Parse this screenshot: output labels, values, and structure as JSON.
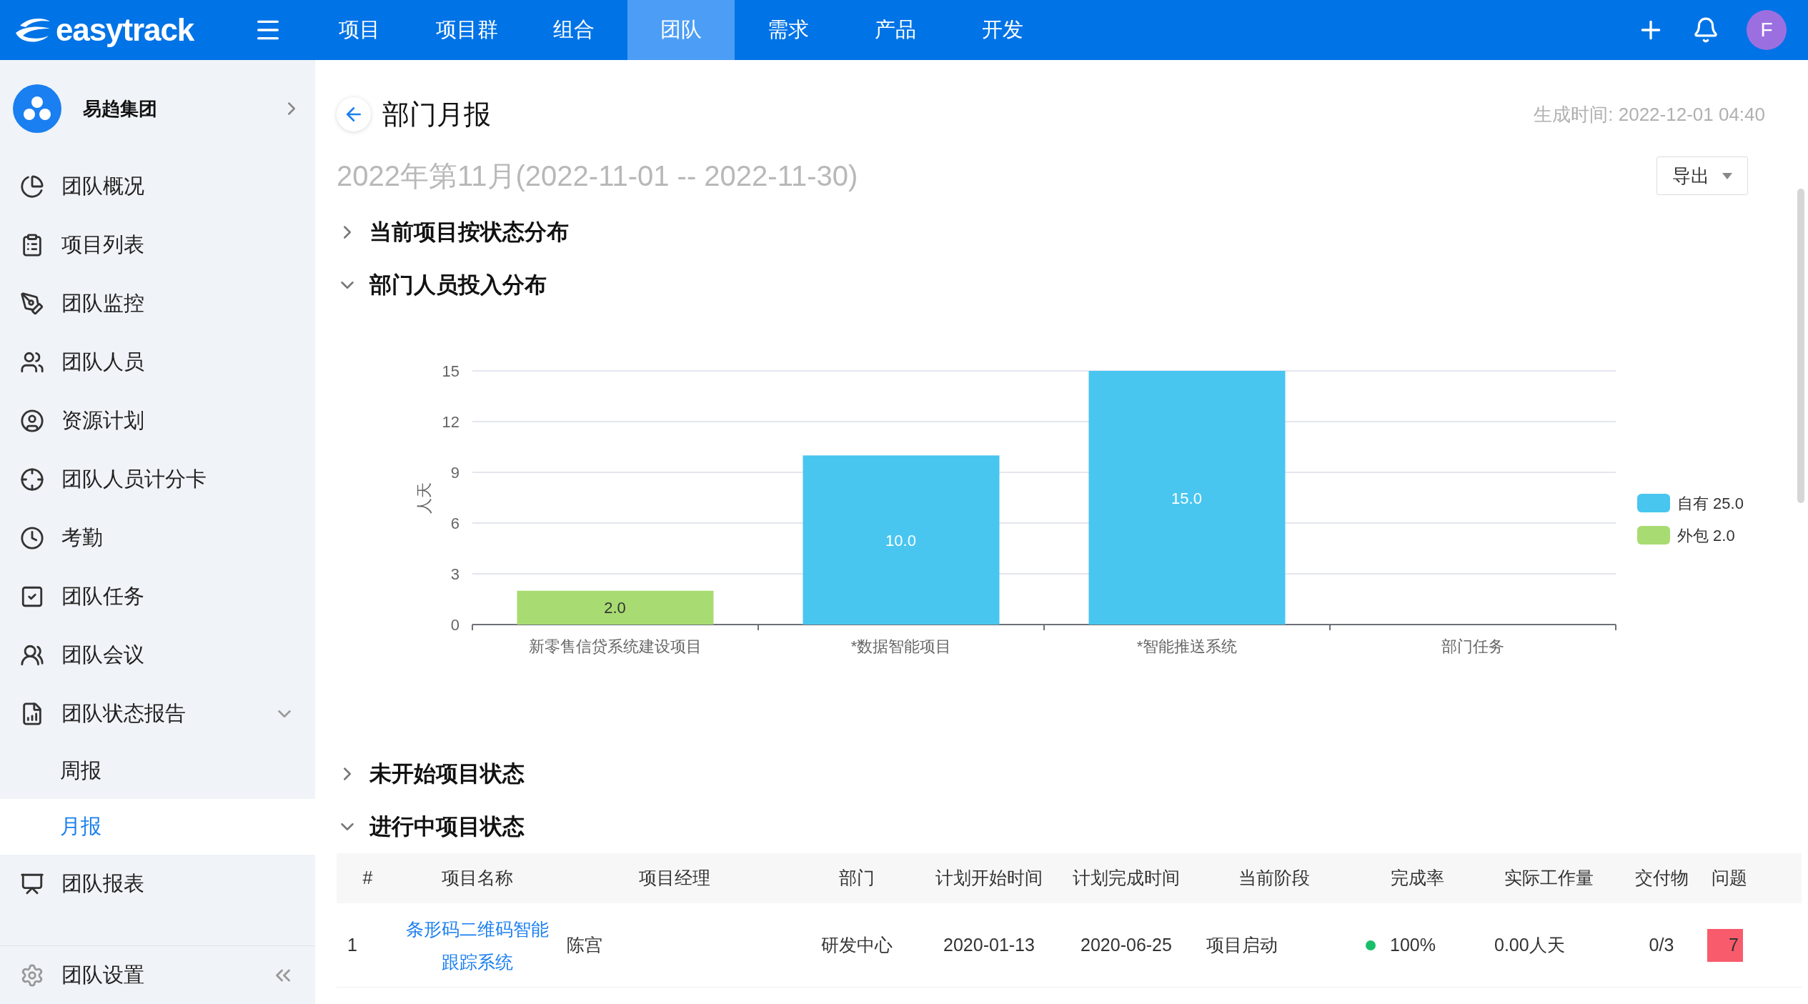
{
  "topbar": {
    "logo": "easytrack",
    "tabs": [
      {
        "label": "项目",
        "selected": false
      },
      {
        "label": "项目群",
        "selected": false
      },
      {
        "label": "组合",
        "selected": false
      },
      {
        "label": "团队",
        "selected": true
      },
      {
        "label": "需求",
        "selected": false
      },
      {
        "label": "产品",
        "selected": false
      },
      {
        "label": "开发",
        "selected": false
      }
    ],
    "avatar": "F"
  },
  "sidebar": {
    "org": "易趋集团",
    "items": [
      {
        "label": "团队概况",
        "selected": false
      },
      {
        "label": "项目列表",
        "selected": false
      },
      {
        "label": "团队监控",
        "selected": false
      },
      {
        "label": "团队人员",
        "selected": false
      },
      {
        "label": "资源计划",
        "selected": false
      },
      {
        "label": "团队人员计分卡",
        "selected": false
      },
      {
        "label": "考勤",
        "selected": false
      },
      {
        "label": "团队任务",
        "selected": false
      },
      {
        "label": "团队会议",
        "selected": false
      },
      {
        "label": "团队状态报告",
        "selected": false,
        "expanded": true,
        "children": [
          {
            "label": "周报",
            "selected": false
          },
          {
            "label": "月报",
            "selected": true
          }
        ]
      },
      {
        "label": "团队报表",
        "selected": false
      }
    ],
    "footer": "团队设置"
  },
  "page": {
    "title": "部门月报",
    "generated": "生成时间: 2022-12-01 04:40",
    "period": "2022年第11月(2022-11-01 -- 2022-11-30)",
    "export": "导出"
  },
  "sections": [
    {
      "title": "当前项目按状态分布",
      "expanded": false
    },
    {
      "title": "部门人员投入分布",
      "expanded": true,
      "chart_data": {
        "type": "bar",
        "ylabel": "人天",
        "categories": [
          "新零售信贷系统建设项目",
          "*数据智能项目",
          "*智能推送系统",
          "部门任务"
        ],
        "grid": true,
        "legend": "right",
        "ylim": [
          0,
          15
        ],
        "yticks": [
          0,
          3,
          6,
          9,
          12,
          15
        ],
        "series": [
          {
            "name": "自有 25.0",
            "color": "#48c6f0",
            "values": [
              null,
              10,
              15,
              null
            ],
            "value_labels": [
              null,
              "10.0",
              "15.0",
              null
            ]
          },
          {
            "name": "外包 2.0",
            "color": "#a8dc72",
            "values": [
              2,
              null,
              null,
              null
            ],
            "value_labels": [
              "2.0",
              null,
              null,
              null
            ]
          }
        ]
      }
    },
    {
      "title": "未开始项目状态",
      "expanded": false
    },
    {
      "title": "进行中项目状态",
      "expanded": true,
      "table": {
        "columns": [
          "#",
          "项目名称",
          "项目经理",
          "部门",
          "计划开始时间",
          "计划完成时间",
          "当前阶段",
          "完成率",
          "实际工作量",
          "交付物",
          "问题"
        ],
        "rows": [
          {
            "index": "1",
            "name": "条形码二维码智能跟踪系统",
            "manager": "陈宫",
            "dept": "研发中心",
            "start": "2020-01-13",
            "end": "2020-06-25",
            "stage": "项目启动",
            "color": "#19be6b",
            "rate": "100%",
            "effort": "0.00人天",
            "deliverables": "0/3",
            "issues": "7"
          }
        ]
      }
    }
  ]
}
